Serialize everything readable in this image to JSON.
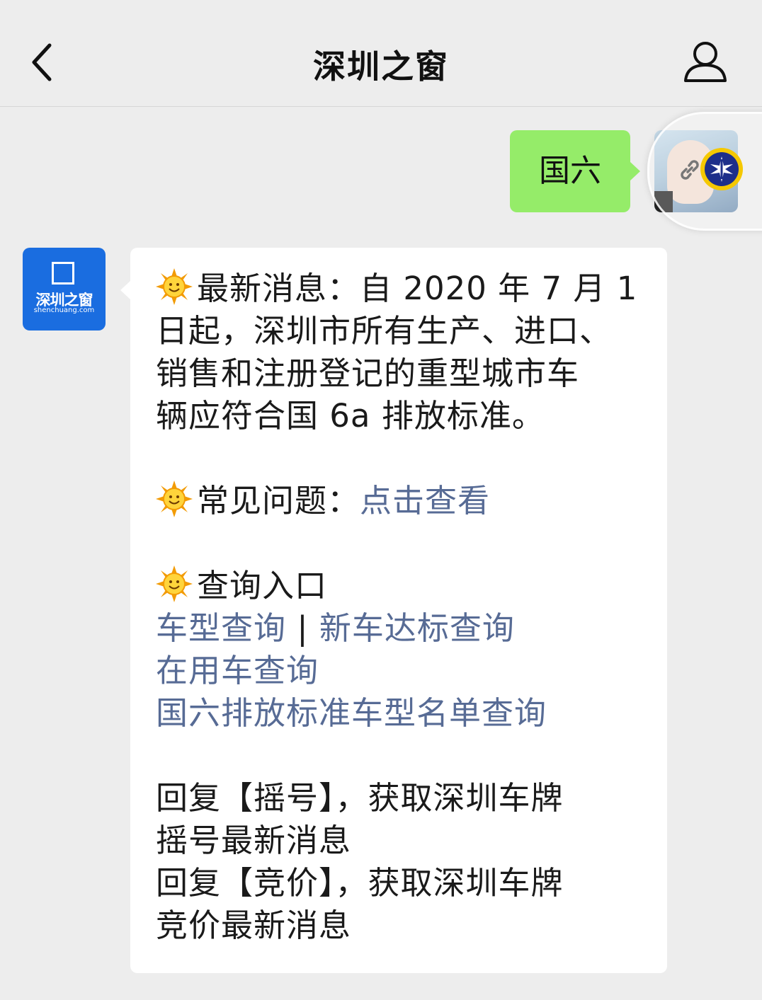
{
  "header": {
    "title": "深圳之窗"
  },
  "sent_message": {
    "text": "国六"
  },
  "bot": {
    "logo_name": "深圳之窗",
    "logo_url": "shenchuang.com"
  },
  "received_message": {
    "news_label": "最新消息：",
    "news_lines": [
      "自 2020 年 7 月 1",
      "日起，深圳市所有生产、进口、",
      "销售和注册登记的重型城市车",
      "辆应符合国 6a 排放标准。"
    ],
    "faq_label": "常见问题：",
    "faq_link": "点击查看",
    "query_label": "查询入口",
    "query_link_1": "车型查询",
    "separator": "|",
    "query_link_2": "新车达标查询",
    "query_link_3": "在用车查询",
    "query_link_4": "国六排放标准车型名单查询",
    "reply_lines": [
      "回复【摇号】，获取深圳车牌",
      "摇号最新消息",
      "回复【竞价】，获取深圳车牌",
      "竞价最新消息"
    ]
  },
  "icons": [
    "back-chevron-icon",
    "profile-icon",
    "link-icon",
    "badge-icon",
    "sun-emoji-icon"
  ],
  "colors": {
    "background": "#ededed",
    "sent_bubble": "#95ec69",
    "received_bubble": "#ffffff",
    "link": "#576b95",
    "bot_avatar": "#1a6de0"
  }
}
